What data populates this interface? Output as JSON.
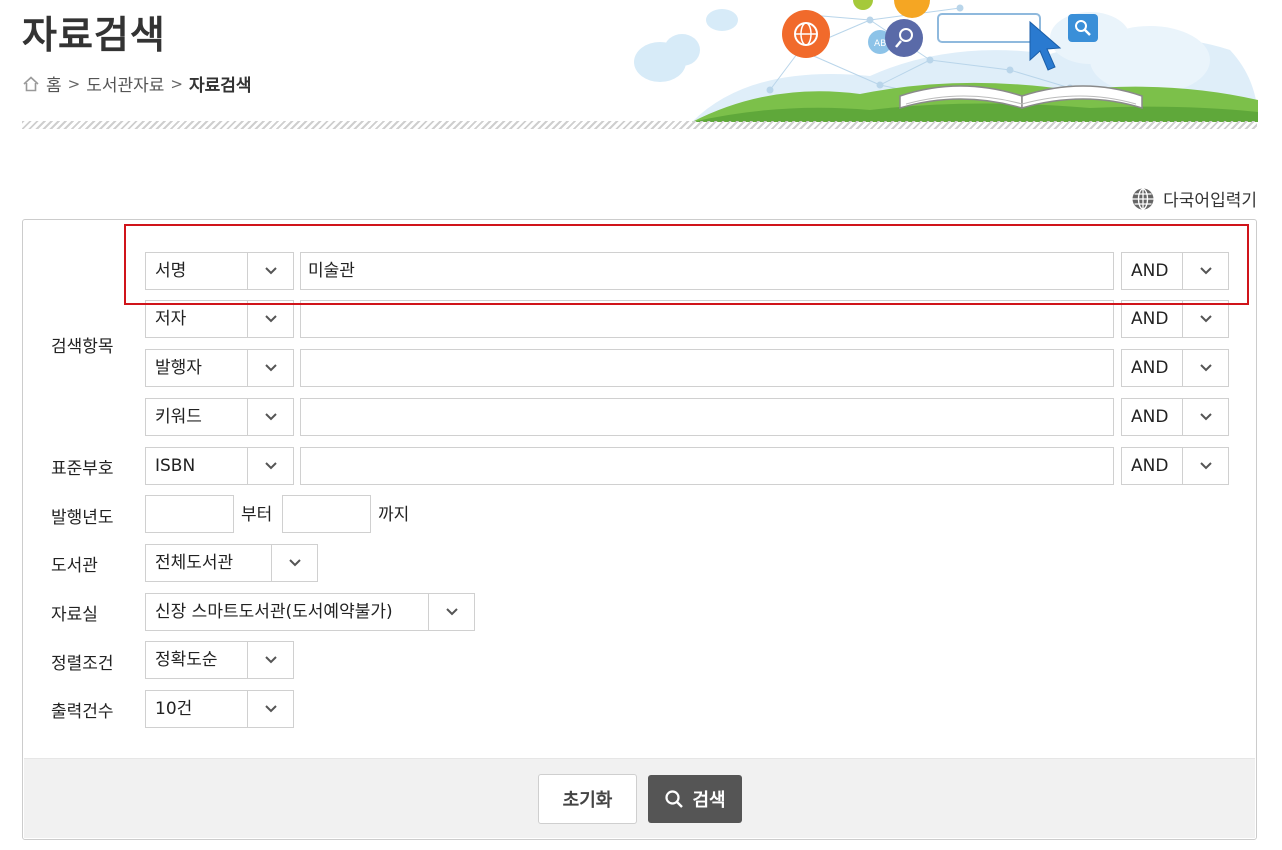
{
  "header": {
    "title": "자료검색",
    "breadcrumb": {
      "home": "홈",
      "section": "도서관자료",
      "current": "자료검색"
    }
  },
  "toolbar": {
    "multilang_label": "다국어입력기"
  },
  "form": {
    "search_items_label": "검색항목",
    "rows": [
      {
        "field": "서명",
        "value": "미술관",
        "op": "AND"
      },
      {
        "field": "저자",
        "value": "",
        "op": "AND"
      },
      {
        "field": "발행자",
        "value": "",
        "op": "AND"
      },
      {
        "field": "키워드",
        "value": "",
        "op": "AND"
      }
    ],
    "standard_number": {
      "label": "표준부호",
      "field": "ISBN",
      "value": "",
      "op": "AND"
    },
    "pub_year": {
      "label": "발행년도",
      "from_value": "",
      "from_suffix": "부터",
      "to_value": "",
      "to_suffix": "까지"
    },
    "library": {
      "label": "도서관",
      "value": "전체도서관"
    },
    "room": {
      "label": "자료실",
      "value": "신장 스마트도서관(도서예약불가)"
    },
    "sort": {
      "label": "정렬조건",
      "value": "정확도순"
    },
    "count": {
      "label": "출력건수",
      "value": "10건"
    }
  },
  "buttons": {
    "reset": "초기화",
    "search": "검색"
  },
  "colors": {
    "highlight": "#d0141a",
    "search_button": "#555555",
    "footer": "#f1f1f1"
  },
  "icons": {
    "home": "home-icon",
    "globe": "globe-icon",
    "chevron": "chevron-down-icon",
    "search": "search-icon"
  }
}
